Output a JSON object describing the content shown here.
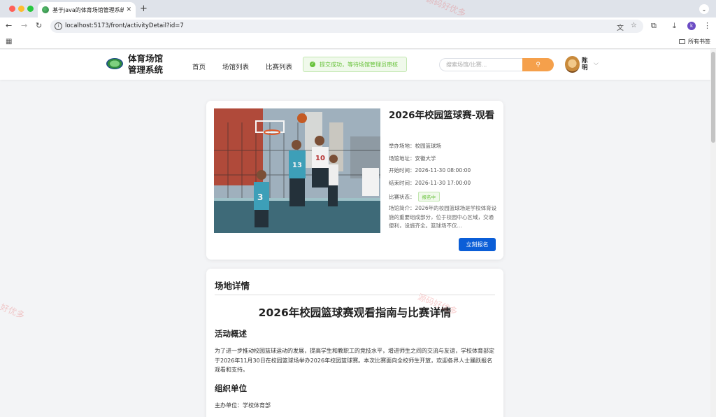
{
  "browser": {
    "tab_title": "基于java的体育场馆管理系统设",
    "tab_close": "✕",
    "new_tab": "+",
    "url": "localhost:5173/front/activityDetail?id=7",
    "bookmarks_label": "所有书签",
    "profile_initial": "k"
  },
  "header": {
    "brand": "体育场馆管理系统",
    "nav": [
      "首页",
      "场馆列表",
      "比赛列表"
    ],
    "toast": "提交成功，等待场馆管理员审核",
    "search_placeholder": "搜索场馆/比赛...",
    "user_name": "陈明"
  },
  "activity": {
    "title": "2026年校园篮球赛-观看",
    "venue_label": "举办场地：",
    "venue": "校园篮球场",
    "address_label": "场馆地址：",
    "address": "安徽大学",
    "start_label": "开始时间：",
    "start": "2026-11-30 08:00:00",
    "end_label": "结束时间：",
    "end": "2026-11-30 17:00:00",
    "status_label": "比赛状态：",
    "status": "报名中",
    "summary": "场馆简介：2026年的校园篮球场是学校体育设施的重要组成部分，位于校园中心区域，交通便利，设施齐全。篮球场不仅...",
    "signup_button": "立刻报名",
    "photo_numbers": [
      "13",
      "10",
      "3"
    ]
  },
  "detail": {
    "heading": "场地详情",
    "doc_title": "2026年校园篮球赛观看指南与比赛详情",
    "overview_title": "活动概述",
    "overview_text": "为了进一步推动校园篮球运动的发展，提高学生和教职工的竞技水平，增进师生之间的交流与友谊，学校体育部定于2026年11月30日在校园篮球场举办2026年校园篮球赛。本次比赛面向全校师生开放，欢迎各界人士踊跃报名观看和支持。",
    "org_title": "组织单位",
    "organizer": "主办单位：学校体育部"
  },
  "watermarks": [
    "源码好优多",
    "好优多",
    "源码好优多"
  ]
}
